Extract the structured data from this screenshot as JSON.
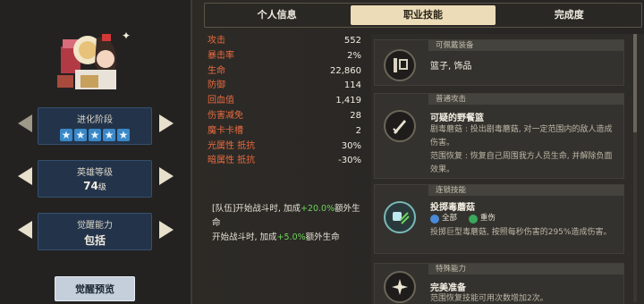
{
  "tabs": [
    "个人信息",
    "职业技能",
    "完成度"
  ],
  "left": {
    "evolution": {
      "label": "进化阶段",
      "stars": 5
    },
    "level": {
      "label": "英雄等级",
      "value": "74",
      "unit": "级"
    },
    "awaken": {
      "label": "觉醒能力",
      "value": "包括"
    },
    "preview_button": "觉醒预览"
  },
  "stats": [
    {
      "k": "攻击",
      "v": "552"
    },
    {
      "k": "暴击率",
      "v": "2%"
    },
    {
      "k": "生命",
      "v": "22,860"
    },
    {
      "k": "防御",
      "v": "114"
    },
    {
      "k": "回血值",
      "v": "1,419"
    },
    {
      "k": "伤害减免",
      "v": "28"
    },
    {
      "k": "魔卡卡槽",
      "v": "2"
    },
    {
      "k": "光属性 抵抗",
      "v": "30%"
    },
    {
      "k": "暗属性 抵抗",
      "v": "-30%"
    }
  ],
  "bonus": {
    "line1_a": "[队伍]开始战斗时, 加成",
    "line1_b": "+20.0%",
    "line1_c": "额外生命",
    "line2_a": "开始战斗时, 加成",
    "line2_b": "+5.0%",
    "line2_c": "额外生命"
  },
  "skills": {
    "equip": {
      "head": "可佩戴装备",
      "text": "篮子, 饰品"
    },
    "normal": {
      "head": "普通攻击",
      "name": "可疑的野餐篮",
      "d1": "剧毒蘑菇 : 投出剧毒蘑菇, 对一定范围内的敌人造成伤害。",
      "d2": "范围恢复 : 恢复自己周围我方人员生命, 并解除负面效果。"
    },
    "chain": {
      "head": "连锁技能",
      "name": "投掷毒蘑菇",
      "tag1": "全部",
      "tag2": "重伤",
      "d1": "投掷巨型毒蘑菇, 按照每秒伤害的295%造成伤害。"
    },
    "special": {
      "head": "特殊能力",
      "name": "完美准备",
      "d1": "范围恢复技能可用次数增加2次。"
    }
  }
}
